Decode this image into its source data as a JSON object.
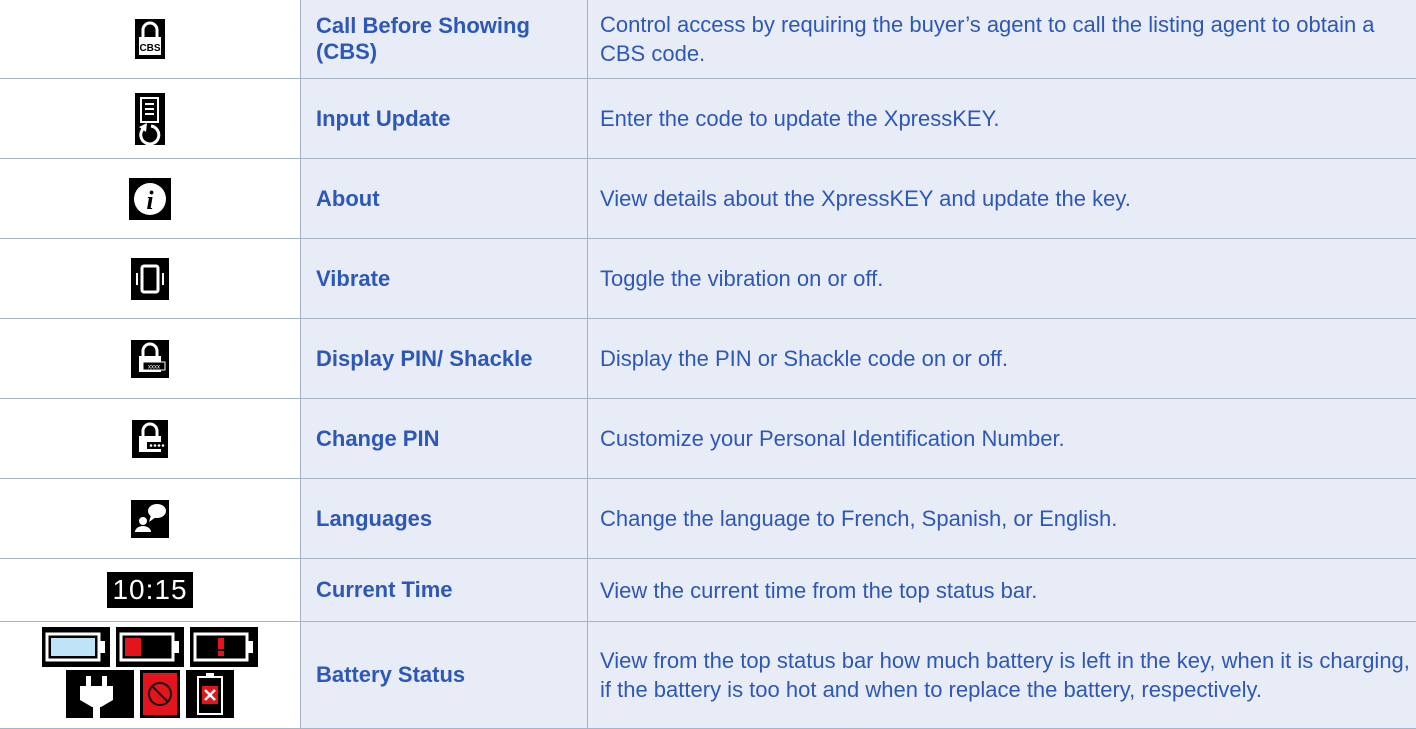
{
  "rows": [
    {
      "icon": "cbs-lock-icon",
      "name": "Call Before Showing (CBS)",
      "description": "Control access by requiring the buyer’s agent to call the listing agent to obtain a CBS code.",
      "icon_text": "CBS"
    },
    {
      "icon": "input-update-icon",
      "name": "Input Update",
      "description": "Enter the code to update the XpressKEY."
    },
    {
      "icon": "info-icon",
      "name": "About",
      "description": "View details about the XpressKEY and update the key.",
      "icon_text": "i"
    },
    {
      "icon": "vibrate-icon",
      "name": "Vibrate",
      "description": "Toggle the vibration on or off."
    },
    {
      "icon": "display-pin-lock-icon",
      "name": "Display PIN/ Shackle",
      "description": "Display the PIN or Shackle code on or off.",
      "icon_text": "xxxx"
    },
    {
      "icon": "change-pin-lock-icon",
      "name": "Change PIN",
      "description": "Customize your Personal Identification Number."
    },
    {
      "icon": "languages-icon",
      "name": "Languages",
      "description": "Change the language to French, Spanish, or English."
    },
    {
      "icon": "clock-icon",
      "name": "Current Time",
      "description": "View the current time from the top status bar.",
      "icon_text": "10:15"
    },
    {
      "icon": "battery-status-icons",
      "name": "Battery Status",
      "description": "View from the top status bar how much battery is left in the key, when it is charging, if the battery is too hot and when to replace the battery, respectively."
    }
  ],
  "colors": {
    "text_blue": "#2e58b6",
    "cell_bg": "#e7ecf6",
    "border": "#a9b3c6",
    "battery_fill_blue": "#bfe4f7",
    "battery_red": "#e3141c"
  }
}
